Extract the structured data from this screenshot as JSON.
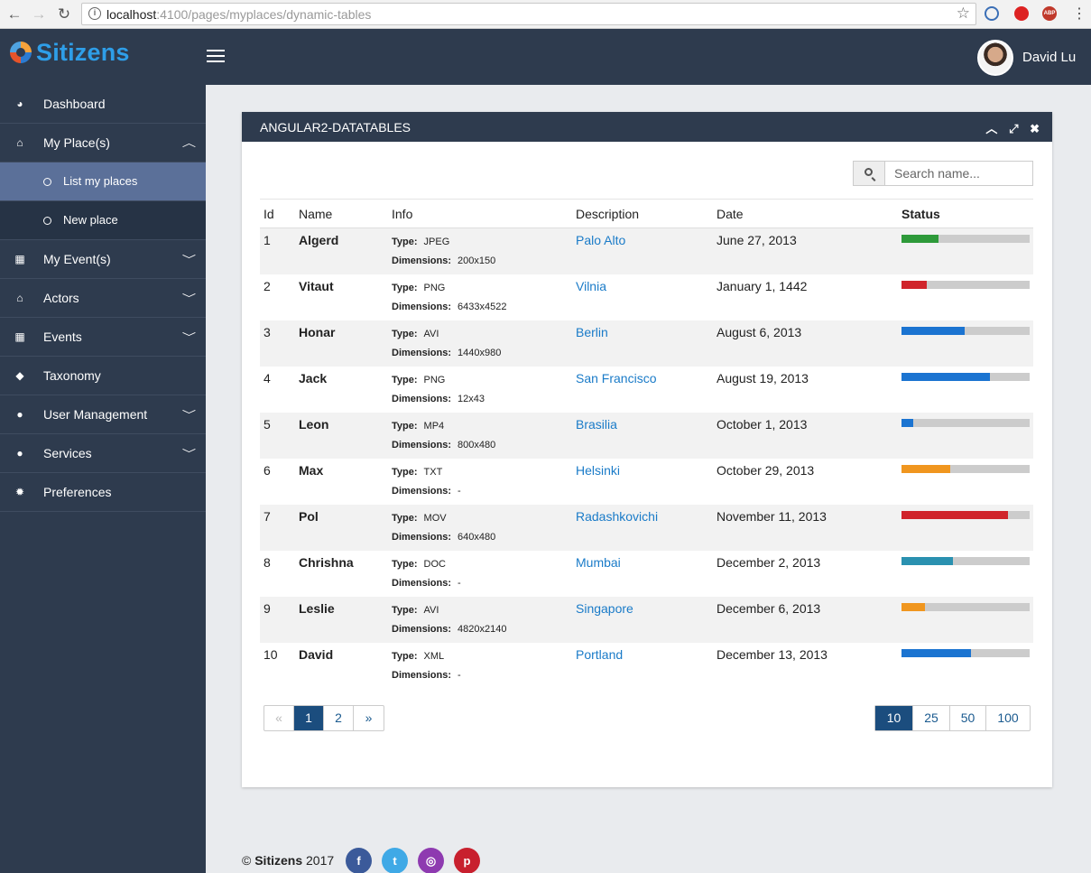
{
  "browser": {
    "url_host": "localhost",
    "url_path": ":4100/pages/myplaces/dynamic-tables"
  },
  "header": {
    "brand": "Sitizens",
    "user_name": "David Lu"
  },
  "sidebar": {
    "items": [
      {
        "label": "Dashboard",
        "icon": "dashboard-icon"
      },
      {
        "label": "My Place(s)",
        "icon": "bank-icon"
      },
      {
        "label": "List my places"
      },
      {
        "label": "New place"
      },
      {
        "label": "My Event(s)",
        "icon": "calendar-icon"
      },
      {
        "label": "Actors",
        "icon": "bank-icon"
      },
      {
        "label": "Events",
        "icon": "calendar-icon"
      },
      {
        "label": "Taxonomy",
        "icon": "tags-icon"
      },
      {
        "label": "User Management",
        "icon": "user-icon"
      },
      {
        "label": "Services",
        "icon": "user-icon"
      },
      {
        "label": "Preferences",
        "icon": "gear-icon"
      }
    ]
  },
  "panel": {
    "title": "ANGULAR2-DATATABLES",
    "search_placeholder": "Search name...",
    "columns": [
      "Id",
      "Name",
      "Info",
      "Description",
      "Date",
      "Status"
    ],
    "info_type_label": "Type:",
    "info_dim_label": "Dimensions:",
    "rows": [
      {
        "id": "1",
        "name": "Algerd",
        "type": "JPEG",
        "dimensions": "200x150",
        "description": "Palo Alto",
        "date": "June 27, 2013",
        "status": 0.29,
        "color": "#2e9a3a"
      },
      {
        "id": "2",
        "name": "Vitaut",
        "type": "PNG",
        "dimensions": "6433x4522",
        "description": "Vilnia",
        "date": "January 1, 1442",
        "status": 0.2,
        "color": "#d0242b"
      },
      {
        "id": "3",
        "name": "Honar",
        "type": "AVI",
        "dimensions": "1440x980",
        "description": "Berlin",
        "date": "August 6, 2013",
        "status": 0.49,
        "color": "#1b74d1"
      },
      {
        "id": "4",
        "name": "Jack",
        "type": "PNG",
        "dimensions": "12x43",
        "description": "San Francisco",
        "date": "August 19, 2013",
        "status": 0.69,
        "color": "#1b74d1"
      },
      {
        "id": "5",
        "name": "Leon",
        "type": "MP4",
        "dimensions": "800x480",
        "description": "Brasilia",
        "date": "October 1, 2013",
        "status": 0.09,
        "color": "#1b74d1"
      },
      {
        "id": "6",
        "name": "Max",
        "type": "TXT",
        "dimensions": "-",
        "description": "Helsinki",
        "date": "October 29, 2013",
        "status": 0.38,
        "color": "#f0961f"
      },
      {
        "id": "7",
        "name": "Pol",
        "type": "MOV",
        "dimensions": "640x480",
        "description": "Radashkovichi",
        "date": "November 11, 2013",
        "status": 0.83,
        "color": "#d0242b"
      },
      {
        "id": "8",
        "name": "Chrishna",
        "type": "DOC",
        "dimensions": "-",
        "description": "Mumbai",
        "date": "December 2, 2013",
        "status": 0.4,
        "color": "#2a91b0"
      },
      {
        "id": "9",
        "name": "Leslie",
        "type": "AVI",
        "dimensions": "4820x2140",
        "description": "Singapore",
        "date": "December 6, 2013",
        "status": 0.18,
        "color": "#f0961f"
      },
      {
        "id": "10",
        "name": "David",
        "type": "XML",
        "dimensions": "-",
        "description": "Portland",
        "date": "December 13, 2013",
        "status": 0.54,
        "color": "#1b74d1"
      }
    ],
    "pager": {
      "prev": "«",
      "pages": [
        "1",
        "2"
      ],
      "next": "»"
    },
    "page_sizes": [
      "10",
      "25",
      "50",
      "100"
    ]
  },
  "footer": {
    "copyright": "©",
    "brand": "Sitizens",
    "year": "2017",
    "social": [
      {
        "icon": "facebook-icon",
        "glyph": "f",
        "color": "#3b5a9a"
      },
      {
        "icon": "twitter-icon",
        "glyph": "t",
        "color": "#3fa9e6"
      },
      {
        "icon": "instagram-icon",
        "glyph": "◎",
        "color": "#8e3ab0"
      },
      {
        "icon": "pinterest-icon",
        "glyph": "p",
        "color": "#c8202e"
      }
    ]
  }
}
